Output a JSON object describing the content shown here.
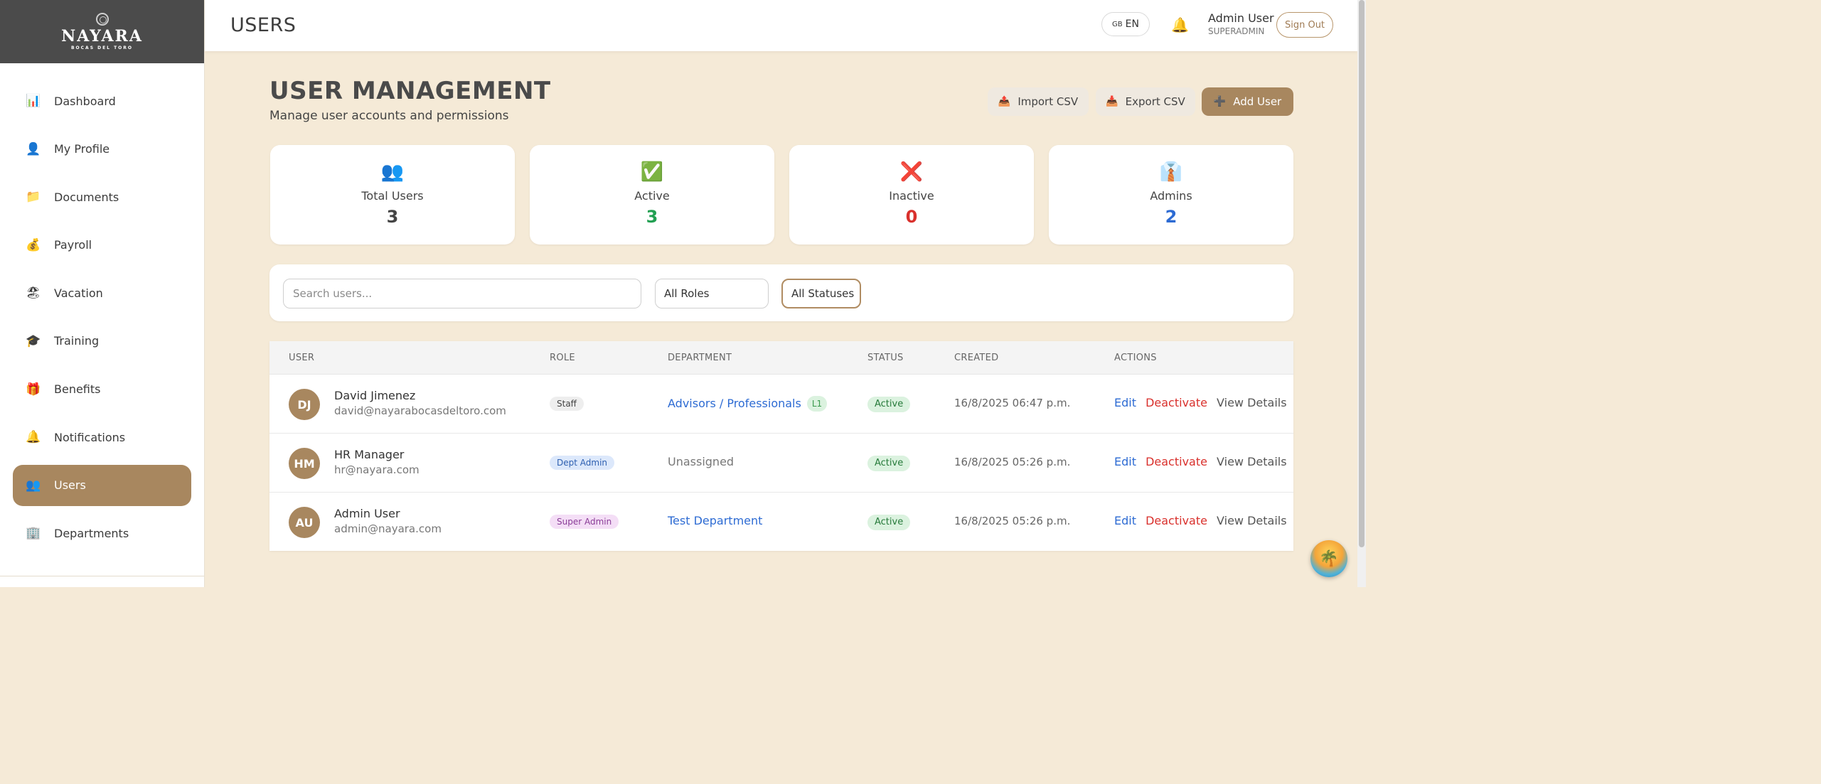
{
  "logo": {
    "title": "NAYARA",
    "subtitle": "BOCAS DEL TORO"
  },
  "sidebar": {
    "items": [
      {
        "label": "Dashboard",
        "icon": "📊",
        "active": false
      },
      {
        "label": "My Profile",
        "icon": "👤",
        "active": false
      },
      {
        "label": "Documents",
        "icon": "📁",
        "active": false
      },
      {
        "label": "Payroll",
        "icon": "💰",
        "active": false
      },
      {
        "label": "Vacation",
        "icon": "🏖",
        "active": false
      },
      {
        "label": "Training",
        "icon": "🎓",
        "active": false
      },
      {
        "label": "Benefits",
        "icon": "🎁",
        "active": false
      },
      {
        "label": "Notifications",
        "icon": "🔔",
        "active": false
      },
      {
        "label": "Users",
        "icon": "👥",
        "active": true
      },
      {
        "label": "Departments",
        "icon": "🏢",
        "active": false
      }
    ]
  },
  "header": {
    "title": "USERS",
    "lang_flag": "GB",
    "lang": "EN",
    "user_name": "Admin User",
    "user_role": "SUPERADMIN",
    "sign_out": "Sign Out"
  },
  "main": {
    "heading": "USER MANAGEMENT",
    "subheading": "Manage user accounts and permissions",
    "buttons": {
      "import": "Import CSV",
      "export": "Export CSV",
      "add": "Add User"
    }
  },
  "stats": [
    {
      "label": "Total Users",
      "value": "3",
      "icon": "👥",
      "color": "#444444"
    },
    {
      "label": "Active",
      "value": "3",
      "icon": "✅",
      "color": "#22a052"
    },
    {
      "label": "Inactive",
      "value": "0",
      "icon": "❌",
      "color": "#d9302c"
    },
    {
      "label": "Admins",
      "value": "2",
      "icon": "👔",
      "color": "#2d6bd3"
    }
  ],
  "filters": {
    "search_placeholder": "Search users...",
    "role": "All Roles",
    "status": "All Statuses"
  },
  "table": {
    "columns": [
      "USER",
      "ROLE",
      "DEPARTMENT",
      "STATUS",
      "CREATED",
      "ACTIONS"
    ],
    "rows": [
      {
        "initials": "DJ",
        "name": "David Jimenez",
        "email": "david@nayarabocasdeltoro.com",
        "role": "Staff",
        "role_bg": "#eeeeee",
        "role_color": "#444444",
        "department": "Advisors / Professionals",
        "dept_level": "L1",
        "status": "Active",
        "created": "16/8/2025 06:47 p.m."
      },
      {
        "initials": "HM",
        "name": "HR Manager",
        "email": "hr@nayara.com",
        "role": "Dept Admin",
        "role_bg": "#dce8fb",
        "role_color": "#2d5fb0",
        "department": "Unassigned",
        "dept_level": "",
        "status": "Active",
        "created": "16/8/2025 05:26 p.m."
      },
      {
        "initials": "AU",
        "name": "Admin User",
        "email": "admin@nayara.com",
        "role": "Super Admin",
        "role_bg": "#f4def6",
        "role_color": "#8a3c97",
        "department": "Test Department",
        "dept_level": "",
        "status": "Active",
        "created": "16/8/2025 05:26 p.m."
      }
    ],
    "actions": {
      "edit": "Edit",
      "deactivate": "Deactivate",
      "view": "View Details"
    }
  }
}
